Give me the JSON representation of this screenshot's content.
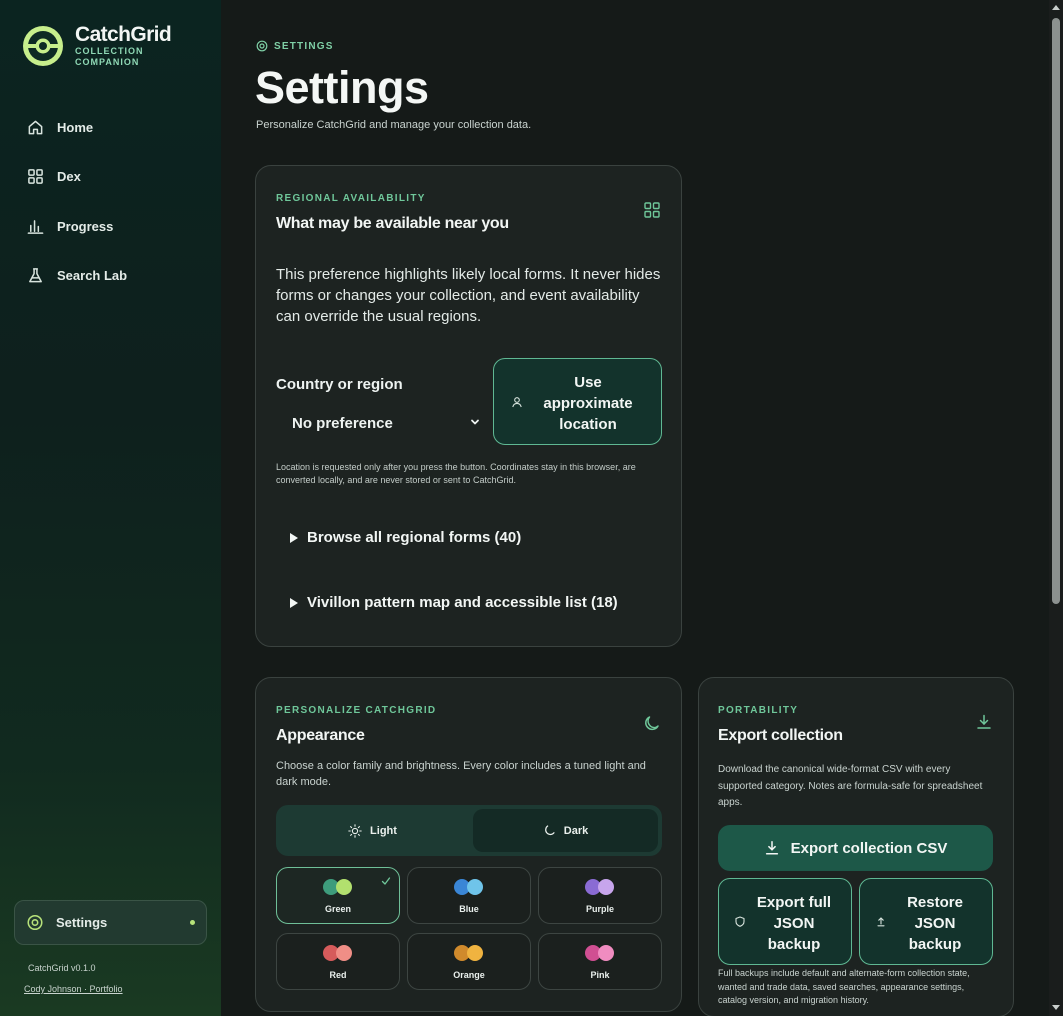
{
  "brand": {
    "name": "CatchGrid",
    "subtitle": "COLLECTION COMPANION",
    "logo_icon": "catchgrid-ball-logo"
  },
  "sidebar": {
    "items": [
      {
        "label": "Home",
        "icon": "home-icon"
      },
      {
        "label": "Dex",
        "icon": "grid-icon"
      },
      {
        "label": "Progress",
        "icon": "bar-chart-icon"
      },
      {
        "label": "Search Lab",
        "icon": "flask-icon"
      }
    ],
    "active": {
      "label": "Settings",
      "icon": "gear-icon"
    },
    "version": "CatchGrid v0.1.0",
    "credit": "Cody Johnson · Portfolio"
  },
  "page": {
    "eyebrow": "SETTINGS",
    "title": "Settings",
    "subtitle": "Personalize CatchGrid and manage your collection data."
  },
  "regional": {
    "kicker": "REGIONAL AVAILABILITY",
    "title": "What may be available near you",
    "description": "This preference highlights likely local forms. It never hides forms or changes your collection, and event availability can override the usual regions.",
    "field_label": "Country or region",
    "select_value": "No preference",
    "location_button": "Use approximate location",
    "note": "Location is requested only after you press the button. Coordinates stay in this browser, are converted locally, and are never stored or sent to CatchGrid.",
    "disclosures": [
      "Browse all regional forms (40)",
      "Vivillon pattern map and accessible list (18)"
    ]
  },
  "appearance": {
    "kicker": "PERSONALIZE CATCHGRID",
    "title": "Appearance",
    "description": "Choose a color family and brightness. Every color includes a tuned light and dark mode.",
    "modes": {
      "light": "Light",
      "dark": "Dark",
      "selected": "Dark"
    },
    "selected_color": "Green",
    "colors": [
      {
        "label": "Green",
        "a": "#3e9c7c",
        "b": "#b2e06e"
      },
      {
        "label": "Blue",
        "a": "#3a86d6",
        "b": "#6fc4ea"
      },
      {
        "label": "Purple",
        "a": "#8a6bd4",
        "b": "#c7a5ec"
      },
      {
        "label": "Red",
        "a": "#d65b5b",
        "b": "#f08e86"
      },
      {
        "label": "Orange",
        "a": "#d08a2c",
        "b": "#f0b340"
      },
      {
        "label": "Pink",
        "a": "#d04f92",
        "b": "#f08cc0"
      }
    ]
  },
  "export": {
    "kicker": "PORTABILITY",
    "title": "Export collection",
    "description": "Download the canonical wide-format CSV with every supported category. Notes are formula-safe for spreadsheet apps.",
    "primary_button": "Export collection CSV",
    "json_button": "Export full JSON backup",
    "restore_button": "Restore JSON backup",
    "note": "Full backups include default and alternate-form collection state, wanted and trade data, saved searches, appearance settings, catalog version, and migration history."
  },
  "colors": {
    "accent": "#6fc79a",
    "background": "#151a18",
    "card": "#1d2321"
  }
}
